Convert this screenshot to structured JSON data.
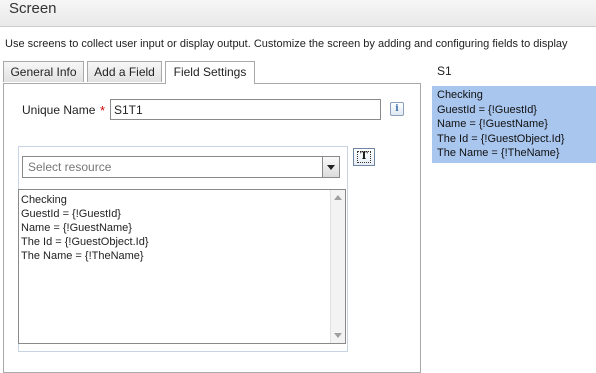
{
  "header": {
    "title": "Screen"
  },
  "description": "Use screens to collect user input or display output. Customize the screen by adding and configuring fields to display",
  "tabs": [
    {
      "label": "General Info"
    },
    {
      "label": "Add a Field"
    },
    {
      "label": "Field Settings"
    }
  ],
  "active_tab": "Field Settings",
  "field_settings": {
    "unique_name_label": "Unique Name",
    "required_mark": "*",
    "unique_name_value": "S1T1",
    "info_icon_text": "i",
    "resource_placeholder": "Select resource",
    "text_button_glyph": "T",
    "textarea_lines": [
      "Checking",
      "GuestId = {!GuestId}",
      "Name = {!GuestName}",
      "The Id = {!GuestObject.Id}",
      "The Name = {!TheName}"
    ]
  },
  "preview": {
    "label": "S1",
    "lines": [
      "Checking",
      "GuestId = {!GuestId}",
      "Name = {!GuestName}",
      "The Id = {!GuestObject.Id}",
      "The Name = {!TheName}"
    ]
  },
  "colors": {
    "preview_background": "#a9c6ef",
    "required": "#cc0000"
  }
}
